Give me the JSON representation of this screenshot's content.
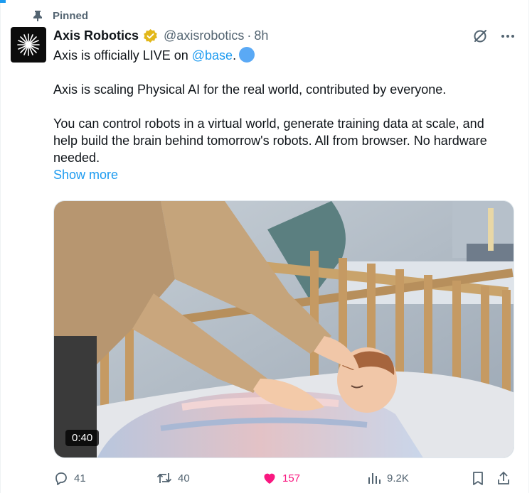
{
  "pinned_label": "Pinned",
  "author": {
    "display_name": "Axis Robotics",
    "handle": "@axisrobotics",
    "separator": "·",
    "time": "8h"
  },
  "tweet": {
    "line1_prefix": "Axis is officially LIVE on ",
    "mention": "@base",
    "line1_suffix": ".",
    "para2": "Axis is scaling Physical AI for the real world, contributed by everyone.",
    "para3": "You can control robots in a virtual world, generate training data at scale, and help build the brain behind tomorrow's robots. All from browser. No hardware needed.",
    "show_more": "Show more"
  },
  "media": {
    "duration": "0:40",
    "icon": "video"
  },
  "stats": {
    "replies": "41",
    "reposts": "40",
    "likes": "157",
    "views": "9.2K"
  },
  "colors": {
    "accent": "#1d9bf0",
    "like": "#f91880",
    "muted": "#536471",
    "verified_gold": "#e2b719"
  },
  "icons": [
    "pin-icon",
    "verified-badge-icon",
    "grok-icon",
    "more-icon",
    "reply-icon",
    "repost-icon",
    "like-icon",
    "views-icon",
    "bookmark-icon",
    "share-icon"
  ]
}
